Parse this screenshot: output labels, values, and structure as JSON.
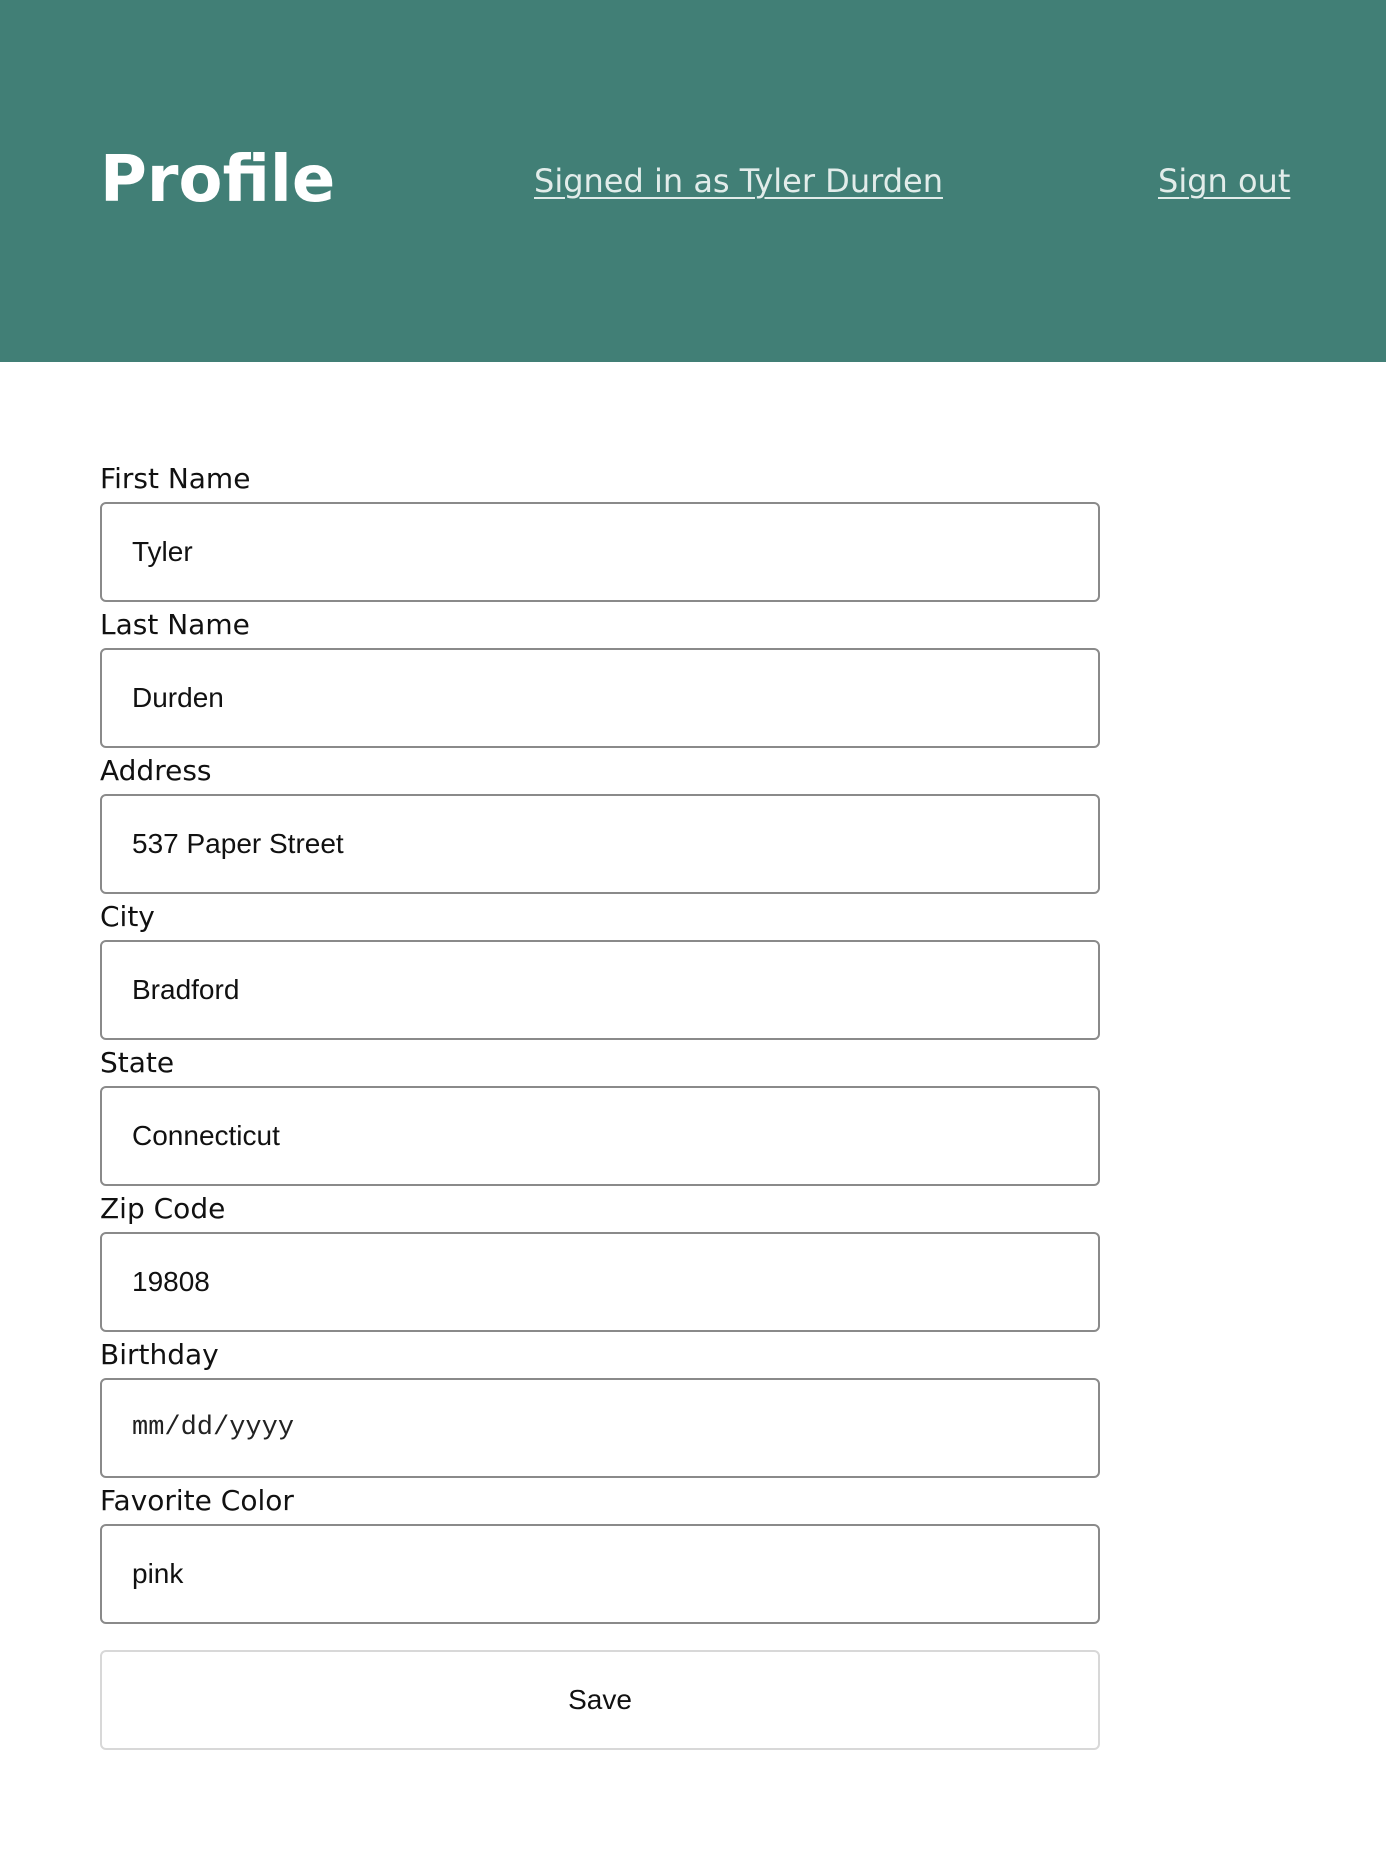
{
  "header": {
    "title": "Profile",
    "signed_in_text": "Signed in as Tyler Durden",
    "sign_out_label": "Sign out",
    "background_color": "#417f76"
  },
  "form": {
    "fields": [
      {
        "label": "First Name",
        "value": "Tyler"
      },
      {
        "label": "Last Name",
        "value": "Durden"
      },
      {
        "label": "Address",
        "value": "537 Paper Street"
      },
      {
        "label": "City",
        "value": "Bradford"
      },
      {
        "label": "State",
        "value": "Connecticut"
      },
      {
        "label": "Zip Code",
        "value": "19808"
      },
      {
        "label": "Birthday",
        "value": "",
        "placeholder": "mm/dd/yyyy"
      },
      {
        "label": "Favorite Color",
        "value": "pink"
      }
    ],
    "save_label": "Save"
  }
}
